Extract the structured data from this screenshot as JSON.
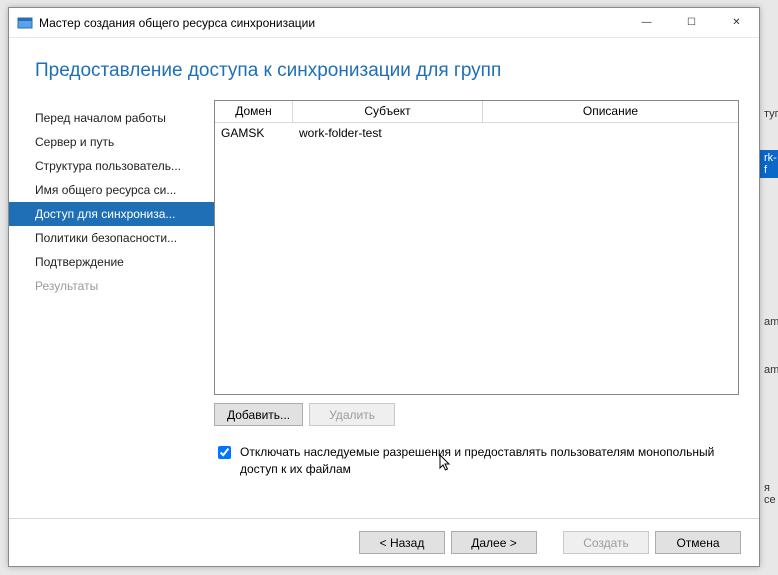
{
  "window": {
    "title": "Мастер создания общего ресурса синхронизации"
  },
  "pageTitle": "Предоставление доступа к синхронизации для групп",
  "steps": [
    {
      "label": "Перед началом работы",
      "state": "done"
    },
    {
      "label": "Сервер и путь",
      "state": "done"
    },
    {
      "label": "Структура пользователь...",
      "state": "done"
    },
    {
      "label": "Имя общего ресурса си...",
      "state": "done"
    },
    {
      "label": "Доступ для синхрониза...",
      "state": "active"
    },
    {
      "label": "Политики безопасности...",
      "state": "pending"
    },
    {
      "label": "Подтверждение",
      "state": "pending"
    },
    {
      "label": "Результаты",
      "state": "disabled"
    }
  ],
  "table": {
    "headers": {
      "domain": "Домен",
      "subject": "Субъект",
      "description": "Описание"
    },
    "rows": [
      {
        "domain": "GAMSK",
        "subject": "work-folder-test",
        "description": ""
      }
    ]
  },
  "tableButtons": {
    "add": "Добавить...",
    "remove": "Удалить"
  },
  "checkbox": {
    "checked": true,
    "label": "Отключать наследуемые разрешения и предоставлять пользователям монопольный доступ к их файлам"
  },
  "footer": {
    "back": "< Назад",
    "next": "Далее >",
    "create": "Создать",
    "cancel": "Отмена"
  },
  "backdrop": {
    "a": "туп",
    "b": "rk-f",
    "c": "am",
    "d": "am",
    "e": "я се"
  }
}
